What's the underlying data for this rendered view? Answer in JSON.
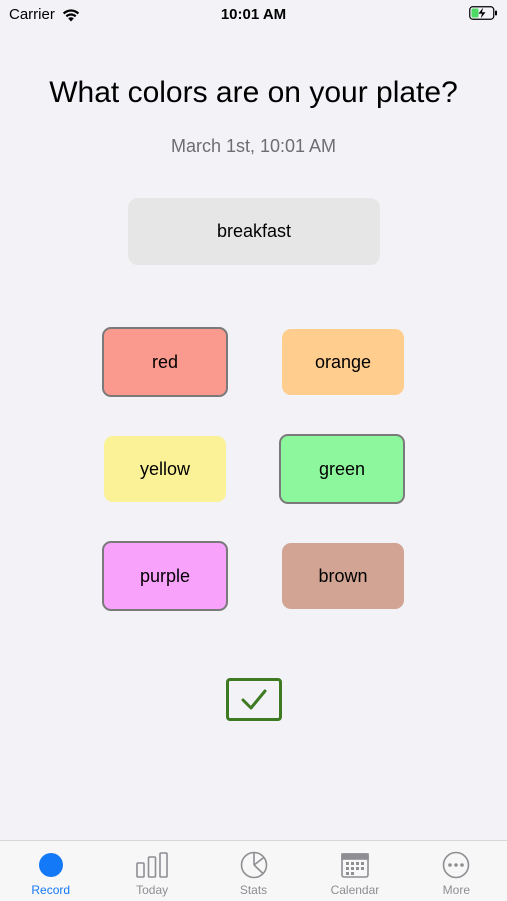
{
  "status_bar": {
    "carrier": "Carrier",
    "time": "10:01 AM"
  },
  "main": {
    "title": "What colors are on your plate?",
    "datetime": "March 1st, 10:01 AM",
    "meal": "breakfast",
    "colors": [
      {
        "label": "red",
        "fill": "#fa9a8f",
        "selected": true
      },
      {
        "label": "orange",
        "fill": "#ffcd8e",
        "selected": false
      },
      {
        "label": "yellow",
        "fill": "#fbf197",
        "selected": false
      },
      {
        "label": "green",
        "fill": "#8df79d",
        "selected": true
      },
      {
        "label": "purple",
        "fill": "#f8a2fb",
        "selected": true
      },
      {
        "label": "brown",
        "fill": "#d2a493",
        "selected": false
      }
    ]
  },
  "tab_bar": {
    "tabs": [
      {
        "label": "Record",
        "icon": "record-dot-icon",
        "active": true
      },
      {
        "label": "Today",
        "icon": "bar-chart-icon",
        "active": false
      },
      {
        "label": "Stats",
        "icon": "pie-chart-icon",
        "active": false
      },
      {
        "label": "Calendar",
        "icon": "calendar-icon",
        "active": false
      },
      {
        "label": "More",
        "icon": "more-icon",
        "active": false
      }
    ]
  },
  "colors": {
    "accent": "#1479f6",
    "confirm": "#3e7a22",
    "inactive_tab": "#8e8e93"
  }
}
